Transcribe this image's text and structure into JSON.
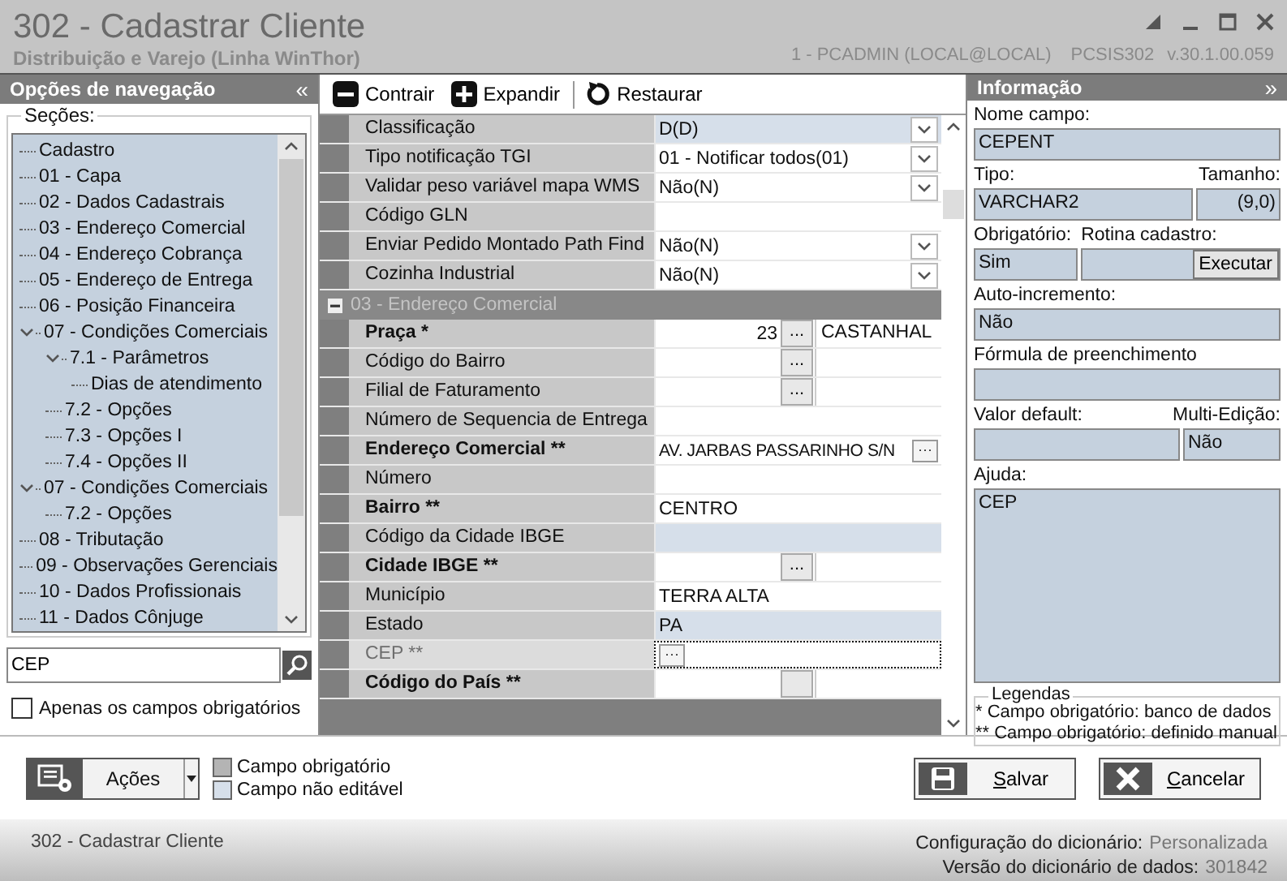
{
  "window": {
    "title": "302 - Cadastrar Cliente",
    "subtitle": "Distribuição e Varejo (Linha WinThor)",
    "user": "1 - PCADMIN (LOCAL@LOCAL)",
    "program": "PCSIS302",
    "version": "v.30.1.00.059"
  },
  "nav": {
    "title": "Opções de navegação",
    "collapse": "«",
    "sections_label": "Seções:",
    "tree": [
      {
        "label": "Cadastro"
      },
      {
        "label": "01 - Capa"
      },
      {
        "label": "02 - Dados Cadastrais"
      },
      {
        "label": "03 - Endereço Comercial"
      },
      {
        "label": "04 - Endereço Cobrança"
      },
      {
        "label": "05 - Endereço de Entrega"
      },
      {
        "label": "06 - Posição Financeira"
      },
      {
        "label": "07 - Condições Comerciais",
        "expanded": true,
        "children": [
          {
            "label": "7.1 - Parâmetros",
            "expanded": true,
            "children": [
              {
                "label": "Dias de atendimento"
              }
            ]
          },
          {
            "label": "7.2 - Opções"
          },
          {
            "label": "7.3 - Opções I"
          },
          {
            "label": "7.4 - Opções II"
          }
        ]
      },
      {
        "label": "07 - Condições Comerciais",
        "expanded": true,
        "children": [
          {
            "label": "7.2 - Opções"
          }
        ]
      },
      {
        "label": "08 - Tributação"
      },
      {
        "label": "09 - Observações Gerenciais"
      },
      {
        "label": "10 - Dados Profissionais"
      },
      {
        "label": "11 - Dados Cônjuge"
      }
    ],
    "search": {
      "value": "CEP"
    },
    "only_required": {
      "label": "Apenas os campos obrigatórios",
      "checked": false
    }
  },
  "toolbar": [
    {
      "label": "Contrair",
      "kind": "collapse"
    },
    {
      "label": "Expandir",
      "kind": "expand"
    },
    {
      "label": "Restaurar",
      "kind": "restore"
    }
  ],
  "grid": {
    "rows": [
      {
        "label": "Classificação",
        "bold": false,
        "kind": "dropdown",
        "value": "D(D)",
        "editable": false,
        "focused": false
      },
      {
        "label": "Tipo notificação TGI",
        "bold": false,
        "kind": "dropdown",
        "value": "01 - Notificar todos(01)",
        "editable": true,
        "focused": false
      },
      {
        "label": "Validar peso variável mapa WMS",
        "bold": false,
        "kind": "dropdown",
        "value": "Não(N)",
        "editable": true,
        "focused": false
      },
      {
        "label": "Código GLN",
        "bold": false,
        "kind": "text",
        "editable": true,
        "focused": false
      },
      {
        "label": "Enviar Pedido Montado Path Find",
        "bold": false,
        "kind": "dropdown",
        "value": "Não(N)",
        "editable": true,
        "focused": false
      },
      {
        "label": "Cozinha Industrial",
        "bold": false,
        "kind": "dropdown",
        "value": "Não(N)",
        "editable": true,
        "focused": false
      }
    ],
    "groups": [
      {
        "title": "03 - Endereço Comercial",
        "expanded": true,
        "rows": [
          {
            "label": "Praça *",
            "bold": true,
            "kind": "lookup",
            "value": "23",
            "button": "...",
            "description": "CASTANHAL",
            "editable": true,
            "focused": false
          },
          {
            "label": "Código do Bairro",
            "bold": false,
            "kind": "lookup",
            "button": "...",
            "editable": true,
            "focused": false
          },
          {
            "label": "Filial de Faturamento",
            "bold": false,
            "kind": "lookup",
            "button": "...",
            "editable": true,
            "focused": false
          },
          {
            "label": "Número de Sequencia de Entrega",
            "bold": false,
            "kind": "text",
            "editable": true,
            "focused": false
          },
          {
            "label": "Endereço Comercial **",
            "bold": true,
            "kind": "ellipsis",
            "value": "AV. JARBAS PASSARINHO S/N",
            "button": "···",
            "editable": true,
            "focused": false
          },
          {
            "label": "Número",
            "bold": false,
            "kind": "text",
            "editable": true,
            "focused": false
          },
          {
            "label": "Bairro **",
            "bold": true,
            "kind": "text",
            "value": "CENTRO",
            "editable": true,
            "focused": false
          },
          {
            "label": "Código da Cidade IBGE",
            "bold": false,
            "kind": "text",
            "editable": false,
            "focused": false
          },
          {
            "label": "Cidade IBGE **",
            "bold": true,
            "kind": "lookup",
            "button": "...",
            "editable": true,
            "focused": false
          },
          {
            "label": "Município",
            "bold": false,
            "kind": "text",
            "value": "TERRA ALTA",
            "editable": true,
            "focused": false
          },
          {
            "label": "Estado",
            "bold": false,
            "kind": "text",
            "value": "PA",
            "editable": false,
            "focused": false
          },
          {
            "label": "CEP **",
            "bold": false,
            "kind": "ellipsis",
            "button": "···",
            "editable": true,
            "focused": true
          },
          {
            "label": "Código do País **",
            "bold": true,
            "kind": "lookup",
            "editable": true,
            "focused": false
          }
        ]
      }
    ]
  },
  "info": {
    "title": "Informação",
    "collapse": "»",
    "field_name": {
      "label": "Nome campo:",
      "value": "CEPENT"
    },
    "type": {
      "label": "Tipo:",
      "value": "VARCHAR2"
    },
    "size": {
      "label": "Tamanho:",
      "value": "(9,0)"
    },
    "required": {
      "label": "Obrigatório:",
      "value": "Sim"
    },
    "routine": {
      "label": "Rotina cadastro:",
      "button": "Executar"
    },
    "auto_increment": {
      "label": "Auto-incremento:",
      "value": "Não"
    },
    "formula": {
      "label": "Fórmula de preenchimento"
    },
    "default_value": {
      "label": "Valor default:"
    },
    "multi_edit": {
      "label": "Multi-Edição:",
      "value": "Não"
    },
    "help": {
      "label": "Ajuda:",
      "value": "CEP"
    },
    "legend": {
      "title": "Legendas",
      "lines": [
        "* Campo obrigatório: banco de dados",
        "** Campo obrigatório: definido manual"
      ]
    }
  },
  "footer": {
    "actions": {
      "label": "Ações"
    },
    "swatches": [
      {
        "label": "Campo obrigatório",
        "color": "#b4b4b4"
      },
      {
        "label": "Campo não editável",
        "color": "#d6dfea"
      }
    ],
    "buttons": [
      {
        "label": "Salvar",
        "kind": "save"
      },
      {
        "label": "Cancelar",
        "kind": "cancel"
      }
    ]
  },
  "status_bar": {
    "left": "302 - Cadastrar Cliente",
    "lines": [
      {
        "label": "Configuração do dicionário:",
        "value": "Personalizada"
      },
      {
        "label": "Versão do dicionário de dados:",
        "value": "301842"
      }
    ]
  }
}
